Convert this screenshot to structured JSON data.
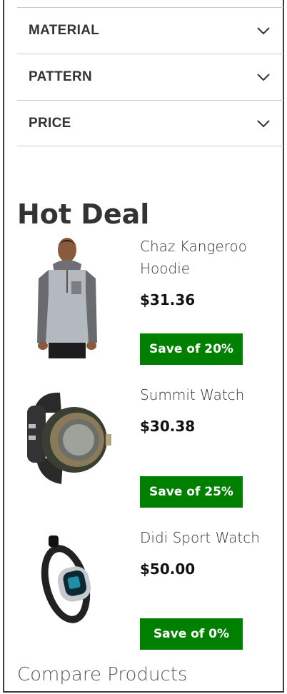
{
  "filters": [
    {
      "label": "MATERIAL"
    },
    {
      "label": "PATTERN"
    },
    {
      "label": "PRICE"
    }
  ],
  "hot_deal": {
    "title": "Hot Deal",
    "products": [
      {
        "name": "Chaz Kangeroo Hoodie",
        "price": "$31.36",
        "save": "Save of 20%"
      },
      {
        "name": "Summit Watch",
        "price": "$30.38",
        "save": "Save of 25%"
      },
      {
        "name": "Didi Sport Watch",
        "price": "$50.00",
        "save": "Save of 0%"
      }
    ]
  },
  "compare": {
    "title": "Compare Products"
  },
  "colors": {
    "badge": "#008000",
    "text": "#333333",
    "divider": "#cccccc"
  },
  "icons": {
    "filter_toggle": "chevron-down-icon"
  }
}
